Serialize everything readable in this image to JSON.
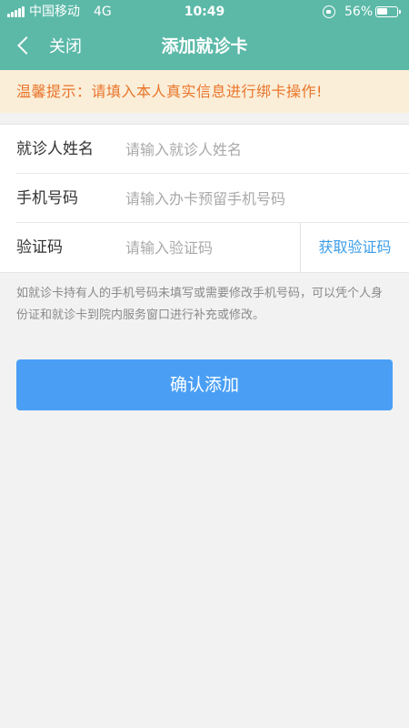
{
  "status_bar": {
    "carrier": "中国移动",
    "network": "4G",
    "time": "10:49",
    "battery": "56%"
  },
  "nav": {
    "back_label": "关闭",
    "title": "添加就诊卡"
  },
  "notice": {
    "text": "温馨提示：请填入本人真实信息进行绑卡操作!"
  },
  "form": {
    "name": {
      "label": "就诊人姓名",
      "placeholder": "请输入就诊人姓名",
      "value": ""
    },
    "phone": {
      "label": "手机号码",
      "placeholder": "请输入办卡预留手机号码",
      "value": ""
    },
    "code": {
      "label": "验证码",
      "placeholder": "请输入验证码",
      "value": "",
      "button_label": "获取验证码"
    }
  },
  "help_text": "如就诊卡持有人的手机号码未填写或需要修改手机号码，可以凭个人身份证和就诊卡到院内服务窗口进行补充或修改。",
  "confirm_label": "确认添加",
  "colors": {
    "header": "#5cb9a8",
    "notice_bg": "#fbeed8",
    "notice_text": "#e8742a",
    "link": "#3d9de8",
    "primary_button": "#4a9ff5"
  }
}
